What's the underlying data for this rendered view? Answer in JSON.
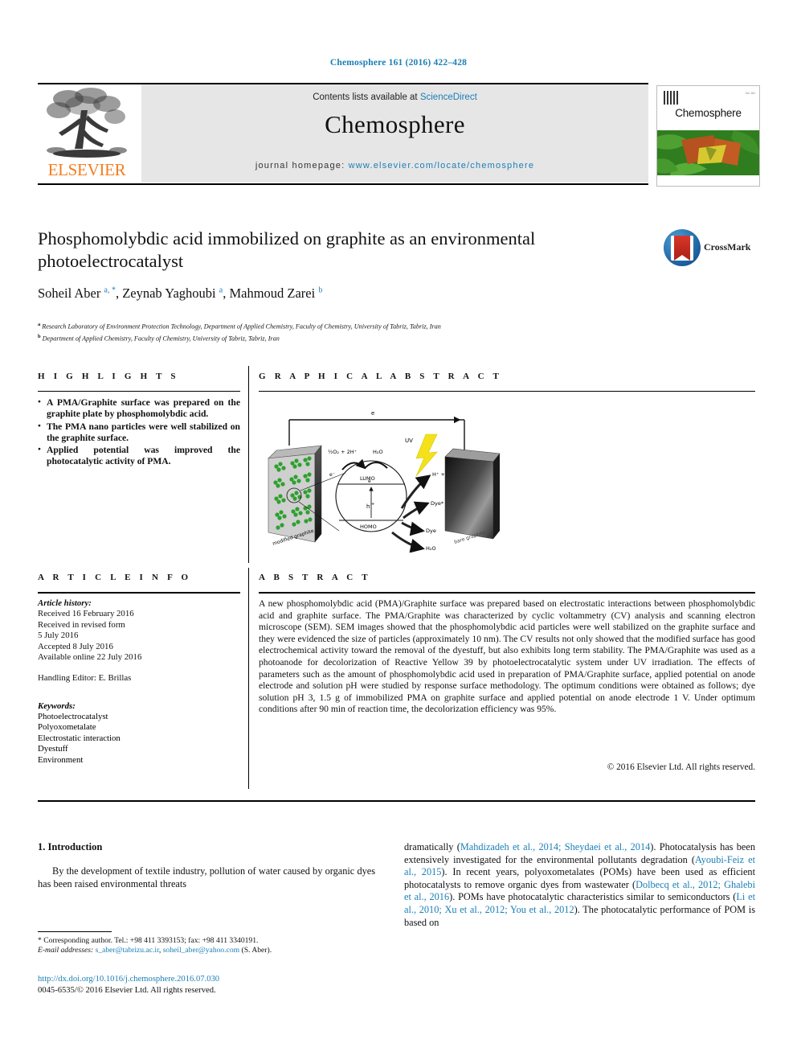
{
  "running_head": "Chemosphere 161 (2016) 422–428",
  "masthead": {
    "contents_prefix": "Contents lists available at ",
    "sciencedirect": "ScienceDirect",
    "journal_name": "Chemosphere",
    "homepage_prefix": "journal homepage: ",
    "homepage_url": "www.elsevier.com/locate/chemosphere",
    "publisher": "ELSEVIER",
    "cover_title": "Chemosphere"
  },
  "crossmark": {
    "label": "CrossMark"
  },
  "article": {
    "title": "Phosphomolybdic acid immobilized on graphite as an environmental photoelectrocatalyst",
    "authors_html": "Soheil Aber <sup>a, *</sup>, Zeynab Yaghoubi <sup>a</sup>, Mahmoud Zarei <sup>b</sup>",
    "affiliations": [
      {
        "mark": "a",
        "text": "Research Laboratory of Environment Protection Technology, Department of Applied Chemistry, Faculty of Chemistry, University of Tabriz, Tabriz, Iran"
      },
      {
        "mark": "b",
        "text": "Department of Applied Chemistry, Faculty of Chemistry, University of Tabriz, Tabriz, Iran"
      }
    ]
  },
  "highlights": {
    "heading": "H I G H L I G H T S",
    "items": [
      "A PMA/Graphite surface was prepared on the graphite plate by phosphomolybdic acid.",
      "The PMA nano particles were well stabilized on the graphite surface.",
      "Applied potential was improved the photocatalytic activity of PMA."
    ]
  },
  "graphical_abstract": {
    "heading": "G R A P H I C A L   A B S T R A C T",
    "labels": {
      "electron_top": "e⁻",
      "uv": "UV",
      "oxygen_eq": "½ O₂ + 2H⁺",
      "water_top": "H₂O",
      "electron_left": "e⁻",
      "lumo": "LUMO",
      "electron_mid": "e⁻",
      "hole": "h⁺",
      "homo": "HOMO",
      "hydroxyl": "H⁺ + OH",
      "dye_star": "Dye*",
      "dye": "Dye",
      "water_bottom": "H₂O",
      "modified": "modified graphite",
      "bare": "bare graphite"
    }
  },
  "article_info": {
    "heading": "A R T I C L E   I N F O",
    "history_label": "Article history:",
    "history": [
      "Received 16 February 2016",
      "Received in revised form",
      "5 July 2016",
      "Accepted 8 July 2016",
      "Available online 22 July 2016"
    ],
    "handling_editor": "Handling Editor: E. Brillas",
    "keywords_label": "Keywords:",
    "keywords": [
      "Photoelectrocatalyst",
      "Polyoxometalate",
      "Electrostatic interaction",
      "Dyestuff",
      "Environment"
    ]
  },
  "abstract": {
    "heading": "A B S T R A C T",
    "text": "A new phosphomolybdic acid (PMA)/Graphite surface was prepared based on electrostatic interactions between phosphomolybdic acid and graphite surface. The PMA/Graphite was characterized by cyclic voltammetry (CV) analysis and scanning electron microscope (SEM). SEM images showed that the phosphomolybdic acid particles were well stabilized on the graphite surface and they were evidenced the size of particles (approximately 10 nm). The CV results not only showed that the modified surface has good electrochemical activity toward the removal of the dyestuff, but also exhibits long term stability. The PMA/Graphite was used as a photoanode for decolorization of Reactive Yellow 39 by photoelectrocatalytic system under UV irradiation. The effects of parameters such as the amount of phosphomolybdic acid used in preparation of PMA/Graphite surface, applied potential on anode electrode and solution pH were studied by response surface methodology. The optimum conditions were obtained as follows; dye solution pH 3, 1.5 g of immobilized PMA on graphite surface and applied potential on anode electrode 1 V. Under optimum conditions after 90 min of reaction time, the decolorization efficiency was 95%.",
    "copyright": "© 2016 Elsevier Ltd. All rights reserved."
  },
  "body": {
    "section_title": "1. Introduction",
    "left_paragraph": "By the development of textile industry, pollution of water caused by organic dyes has been raised environmental threats",
    "right_column": {
      "p1_a": "dramatically (",
      "c1": "Mahdizadeh et al., 2014; Sheydaei et al., 2014",
      "p1_b": "). Photocatalysis has been extensively investigated for the environmental pollutants degradation (",
      "c2": "Ayoubi-Feiz et al., 2015",
      "p1_c": "). In recent years, polyoxometalates (POMs) have been used as efficient photocatalysts to remove organic dyes from wastewater (",
      "c3": "Dolbecq et al., 2012; Ghalebi et al., 2016",
      "p1_d": "). POMs have photocatalytic characteristics similar to semiconductors (",
      "c4": "Li et al., 2010; Xu et al., 2012; You et al., 2012",
      "p1_e": "). The photocatalytic performance of POM is based on"
    }
  },
  "footnote": {
    "corresponding": "* Corresponding author. Tel.: +98 411 3393153; fax: +98 411 3340191.",
    "email_label": "E-mail addresses: ",
    "email1": "s_aber@tabrizu.ac.ir",
    "email_sep": ", ",
    "email2": "soheil_aber@yahoo.com",
    "email_suffix": " (S. Aber)."
  },
  "footer": {
    "doi": "http://dx.doi.org/10.1016/j.chemosphere.2016.07.030",
    "issn": "0045-6535/© 2016 Elsevier Ltd. All rights reserved."
  },
  "colors": {
    "link_blue": "#1a7fb5",
    "elsevier_orange": "#F47D20",
    "cover_green": "#2f7d1f",
    "uv_yellow": "#f5e11a"
  }
}
